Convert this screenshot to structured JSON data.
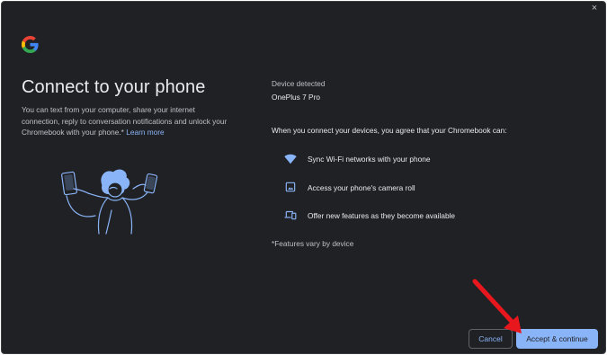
{
  "dialog": {
    "close_label": "×",
    "title": "Connect to your phone",
    "description": "You can text from your computer, share your internet connection, reply to conversation notifications and unlock your Chromebook with your phone.*",
    "learn_more": "Learn more",
    "device_label": "Device detected",
    "device_name": "OnePlus 7 Pro",
    "agreement": "When you connect your devices, you agree that your Chromebook can:",
    "permissions": [
      {
        "icon": "wifi-icon",
        "label": "Sync Wi-Fi networks with your phone"
      },
      {
        "icon": "image-icon",
        "label": "Access your phone's camera roll"
      },
      {
        "icon": "devices-icon",
        "label": "Offer new features as they become available"
      }
    ],
    "footnote": "*Features vary by device",
    "cancel_label": "Cancel",
    "accept_label": "Accept & continue"
  },
  "colors": {
    "background": "#202124",
    "primary_text": "#e8eaed",
    "secondary_text": "#bdc1c6",
    "accent": "#8ab4f8",
    "annotation_arrow": "#e8161d"
  }
}
